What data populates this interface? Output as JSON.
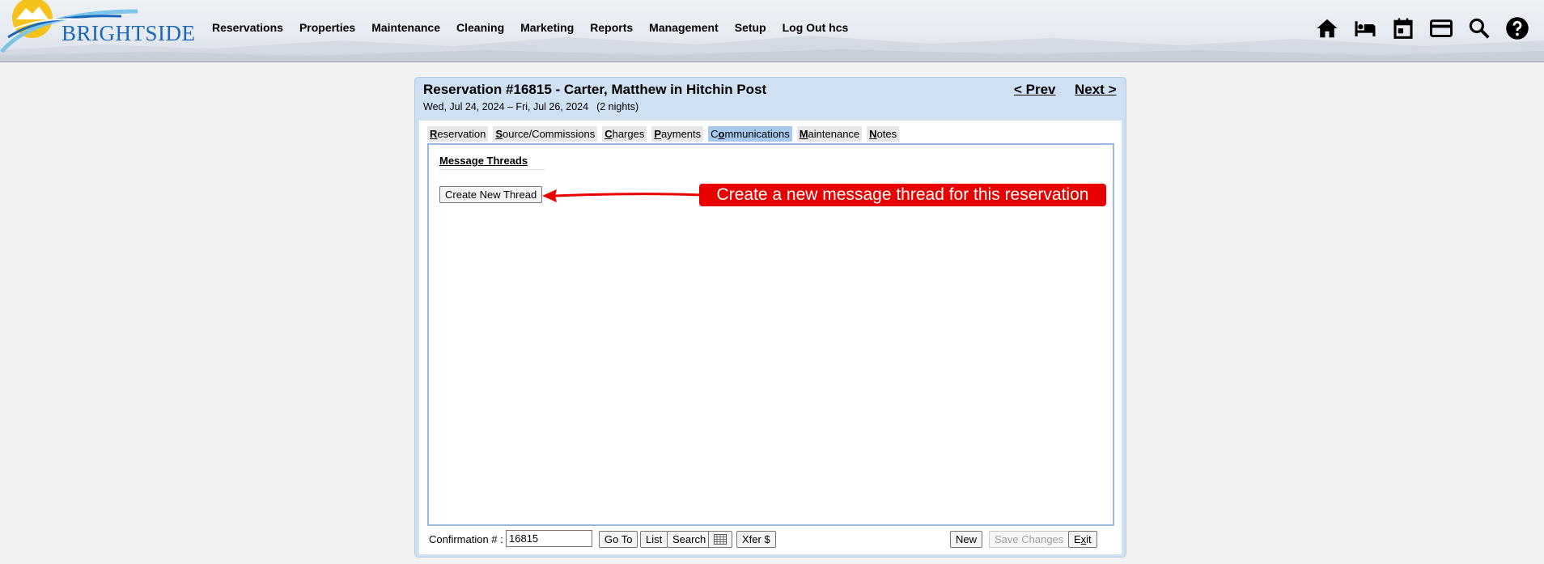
{
  "app": {
    "logo_text": "BRIGHTSIDE",
    "nav": [
      "Reservations",
      "Properties",
      "Maintenance",
      "Cleaning",
      "Marketing",
      "Reports",
      "Management",
      "Setup",
      "Log Out hcs"
    ],
    "icons": [
      "home-icon",
      "bed-icon",
      "calendar-icon",
      "credit-card-icon",
      "search-icon",
      "help-icon"
    ]
  },
  "reservation": {
    "title": "Reservation #16815 - Carter, Matthew in Hitchin Post",
    "dates": "Wed, Jul 24, 2024 – Fri, Jul 26, 2024",
    "nights": "(2 nights)",
    "prev_label": "< Prev",
    "next_label": "Next >"
  },
  "tabs": [
    {
      "key": "R",
      "rest": "eservation",
      "active": false
    },
    {
      "key": "S",
      "rest": "ource/Commissions",
      "active": false
    },
    {
      "key": "C",
      "rest": "harges",
      "active": false
    },
    {
      "key": "P",
      "rest": "ayments",
      "active": false
    },
    {
      "pre": "C",
      "key": "o",
      "rest": "mmunications",
      "active": true
    },
    {
      "key": "M",
      "rest": "aintenance",
      "active": false
    },
    {
      "key": "N",
      "rest": "otes",
      "active": false
    }
  ],
  "communications": {
    "heading": "Message Threads",
    "create_button": "Create New Thread"
  },
  "annotation": {
    "text": "Create a new message thread for this reservation",
    "color": "#e80000"
  },
  "footer": {
    "confirmation_label": "Confirmation # :",
    "confirmation_value": "16815",
    "goto_label": "Go To",
    "list_label": "List",
    "search_label": "Search",
    "calendar_icon": "calendar-grid-icon",
    "xfer_label": "Xfer $",
    "new_label": "New",
    "save_label": "Save Changes",
    "exit_label": "Exit",
    "exit_key": "x"
  },
  "colors": {
    "panel_bg": "#cfe0f3",
    "active_tab": "#a8c9ee",
    "brand_blue": "#1a67b8"
  }
}
